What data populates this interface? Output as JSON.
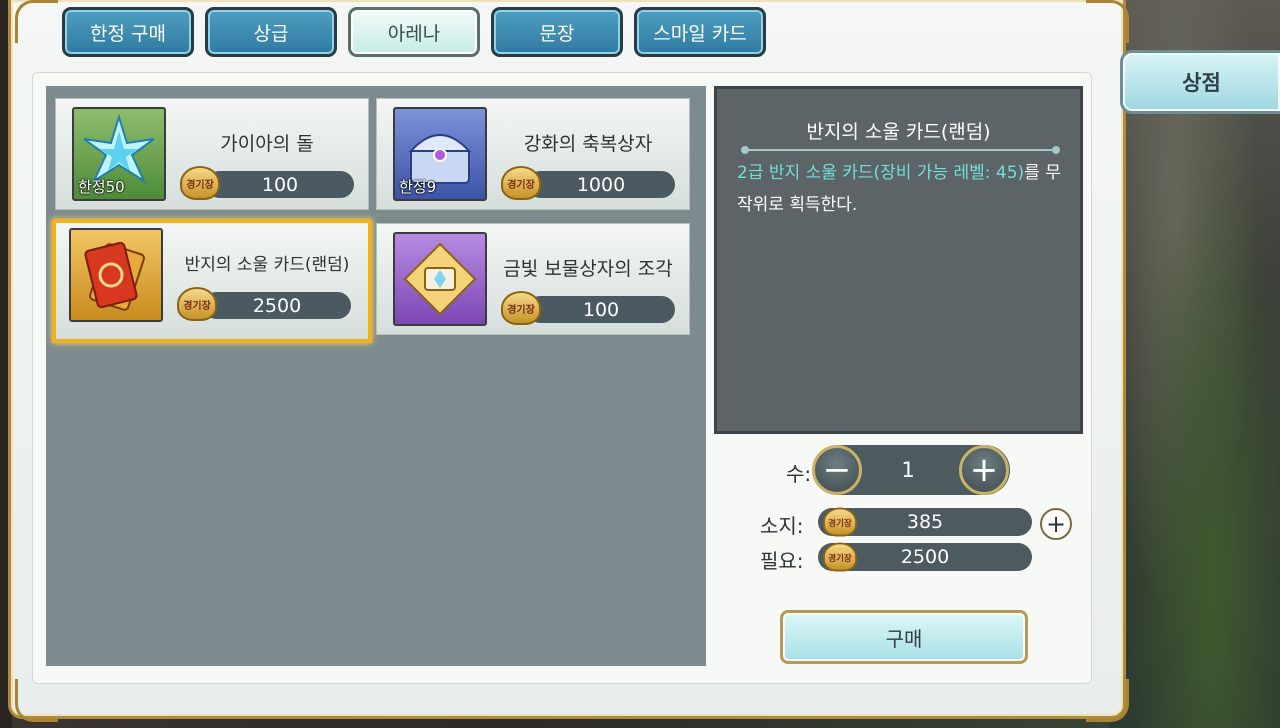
{
  "tabs": [
    {
      "label": "한정 구매",
      "active": false
    },
    {
      "label": "상급",
      "active": false
    },
    {
      "label": "아레나",
      "active": true
    },
    {
      "label": "문장",
      "active": false
    },
    {
      "label": "스마일 카드",
      "active": false
    }
  ],
  "side_tab": {
    "label": "상점"
  },
  "currency": {
    "label": "경기장",
    "icon": "arena-medal-icon"
  },
  "items": [
    {
      "name": "가이아의 돌",
      "limit": "한정50",
      "price": "100",
      "icon": "star-crystal-icon",
      "selected": false
    },
    {
      "name": "강화의 축복상자",
      "limit": "한정9",
      "price": "1000",
      "icon": "treasure-chest-icon",
      "selected": false
    },
    {
      "name": "반지의 소울 카드(랜덤)",
      "limit": "",
      "price": "2500",
      "icon": "soul-card-icon",
      "selected": true
    },
    {
      "name": "금빛 보물상자의 조각",
      "limit": "",
      "price": "100",
      "icon": "chest-fragment-icon",
      "selected": false
    }
  ],
  "detail": {
    "title": "반지의 소울 카드(랜덤)",
    "desc_highlight": "2급 반지 소울 카드(장비 가능 레벨: 45)",
    "desc_rest": "를 무작위로 획득한다."
  },
  "quantity": {
    "label": "수:",
    "value": "1",
    "minus": "−",
    "plus": "+"
  },
  "owned": {
    "label": "소지:",
    "value": "385",
    "add": "+"
  },
  "required": {
    "label": "필요:",
    "value": "2500"
  },
  "buy_button": {
    "label": "구매"
  },
  "colors": {
    "accent": "#f2b21a",
    "tab_blue": "#3a86ae",
    "panel_dark": "#5c6468",
    "highlight_text": "#6fe0d6"
  }
}
